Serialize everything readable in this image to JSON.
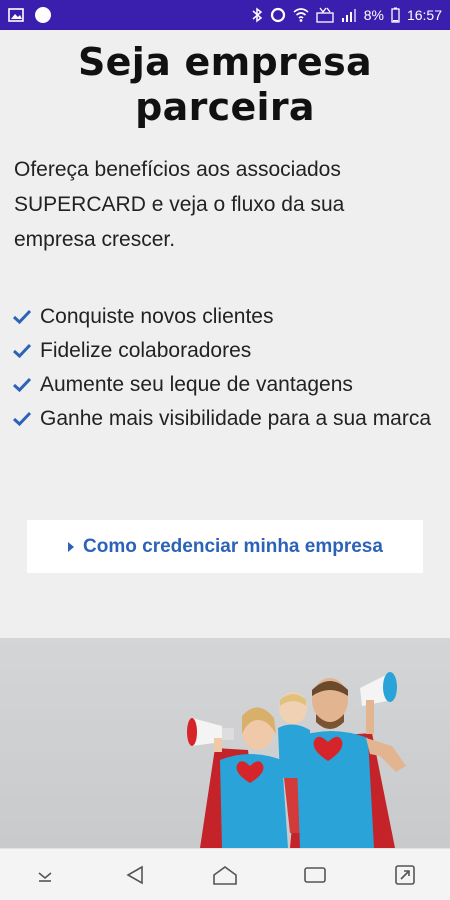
{
  "status_bar": {
    "battery": "8%",
    "time": "16:57",
    "icons": [
      "image-icon",
      "circle-icon",
      "bluetooth-icon",
      "data-saver-icon",
      "wifi-icon",
      "volte-icon",
      "signal-icon",
      "battery-icon"
    ]
  },
  "page": {
    "title_line1": "Seja empresa",
    "title_line2": "parceira",
    "intro": "Ofereça benefícios aos associados SUPERCARD e veja o fluxo da sua empresa crescer.",
    "benefits": [
      "Conquiste novos clientes",
      "Fidelize colaboradores",
      "Aumente seu leque de vantagens",
      "Ganhe mais visibilidade para a sua marca"
    ],
    "cta_label": "Como credenciar minha empresa"
  },
  "colors": {
    "status_bar": "#3a1fae",
    "background": "#efefef",
    "accent": "#2c63b8",
    "shirt": "#2aa3d8",
    "cape": "#c4232a"
  },
  "nav_bar": {
    "icons": [
      "download-icon",
      "back-icon",
      "home-icon",
      "recents-icon",
      "expand-icon"
    ]
  }
}
